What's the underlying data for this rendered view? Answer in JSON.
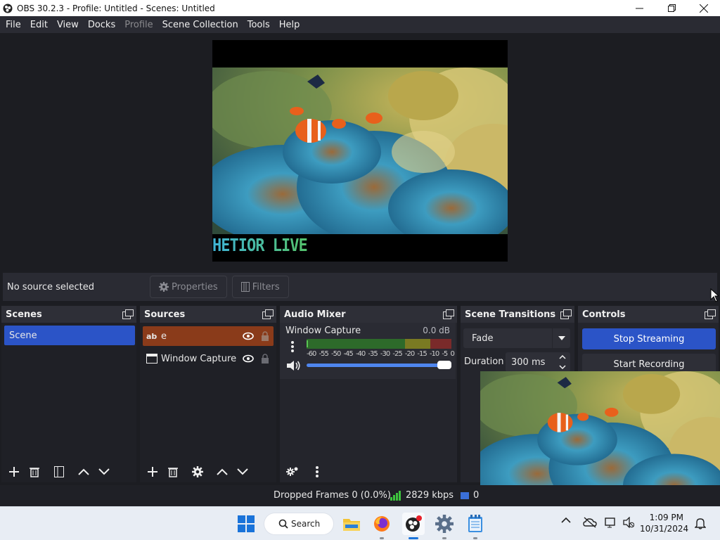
{
  "window": {
    "title": "OBS 30.2.3 - Profile: Untitled - Scenes: Untitled"
  },
  "menu": [
    "File",
    "Edit",
    "View",
    "Docks",
    "Profile",
    "Scene Collection",
    "Tools",
    "Help"
  ],
  "preview": {
    "overlay_text": "HETIOR LIVE"
  },
  "source_toolbar": {
    "status": "No source selected",
    "properties_label": "Properties",
    "filters_label": "Filters"
  },
  "docks": {
    "scenes": {
      "title": "Scenes",
      "items": [
        "Scene"
      ]
    },
    "sources": {
      "title": "Sources",
      "items": [
        {
          "name": "e",
          "type": "text-gdi",
          "icon": "text-icon"
        },
        {
          "name": "Window Capture",
          "type": "window",
          "icon": "window-capture-icon"
        }
      ]
    },
    "audio_mixer": {
      "title": "Audio Mixer",
      "channel": {
        "name": "Window Capture",
        "level": "0.0 dB",
        "volume": 1.0,
        "scale": [
          "-60",
          "-55",
          "-50",
          "-45",
          "-40",
          "-35",
          "-30",
          "-25",
          "-20",
          "-15",
          "-10",
          "-5",
          "0"
        ]
      }
    },
    "transitions": {
      "title": "Scene Transitions",
      "selected": "Fade",
      "duration_label": "Duration",
      "duration_value": "300 ms"
    },
    "controls": {
      "title": "Controls",
      "stop_streaming": "Stop Streaming",
      "start_recording": "Start Recording"
    }
  },
  "statusbar": {
    "dropped_frames": "Dropped Frames 0 (0.0%)",
    "bitrate": "2829 kbps",
    "partial": "0"
  },
  "taskbar": {
    "search_label": "Search",
    "time": "1:09 PM",
    "date": "10/31/2024"
  },
  "colors": {
    "accent_blue": "#2b54c7",
    "selected_source": "#8a3b1a",
    "panel_bg": "#24252c",
    "app_bg": "#1c1d22"
  }
}
